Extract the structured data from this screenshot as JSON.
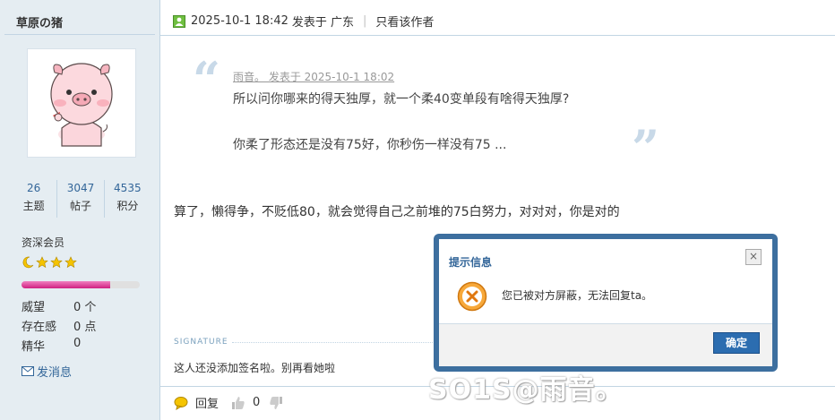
{
  "author": {
    "name": "草原の猪",
    "stats": [
      {
        "value": "26",
        "label": "主题"
      },
      {
        "value": "3047",
        "label": "帖子"
      },
      {
        "value": "4535",
        "label": "积分"
      }
    ],
    "level": "资深会员",
    "star_icons": [
      "moon-icon",
      "star-icon",
      "star-icon",
      "star-icon"
    ],
    "progress_percent": 75,
    "props": [
      {
        "label": "威望",
        "value": "0 个"
      },
      {
        "label": "存在感",
        "value": "0 点"
      },
      {
        "label": "精华",
        "value": "0"
      }
    ],
    "message_link": "发消息"
  },
  "post": {
    "header": {
      "date": "2025-10-1 18:42",
      "posted_in": "发表于 广东",
      "only_author": "只看该作者"
    },
    "quote": {
      "meta": "雨音。 发表于 2025-10-1 18:02",
      "line1": "所以问你哪来的得天独厚，就一个柔40变单段有啥得天独厚?",
      "line2": "你柔了形态还是没有75好，你秒伤一样没有75 ..."
    },
    "body": "算了，懒得争，不贬低80，就会觉得自己之前堆的75白努力，对对对，你是对的",
    "signature_label": "SIGNATURE",
    "signature": "这人还没添加签名啦。别再看她啦",
    "actions": {
      "reply": "回复",
      "likes": "0"
    }
  },
  "dialog": {
    "title": "提示信息",
    "close": "×",
    "message": "您已被对方屏蔽，无法回复ta。",
    "ok": "确定"
  },
  "watermark": "SO1S@雨音。",
  "colors": {
    "sidebar_bg": "#e5edf2",
    "link": "#336699",
    "dialog_border": "#3d6f9f",
    "button": "#2c6db0"
  }
}
